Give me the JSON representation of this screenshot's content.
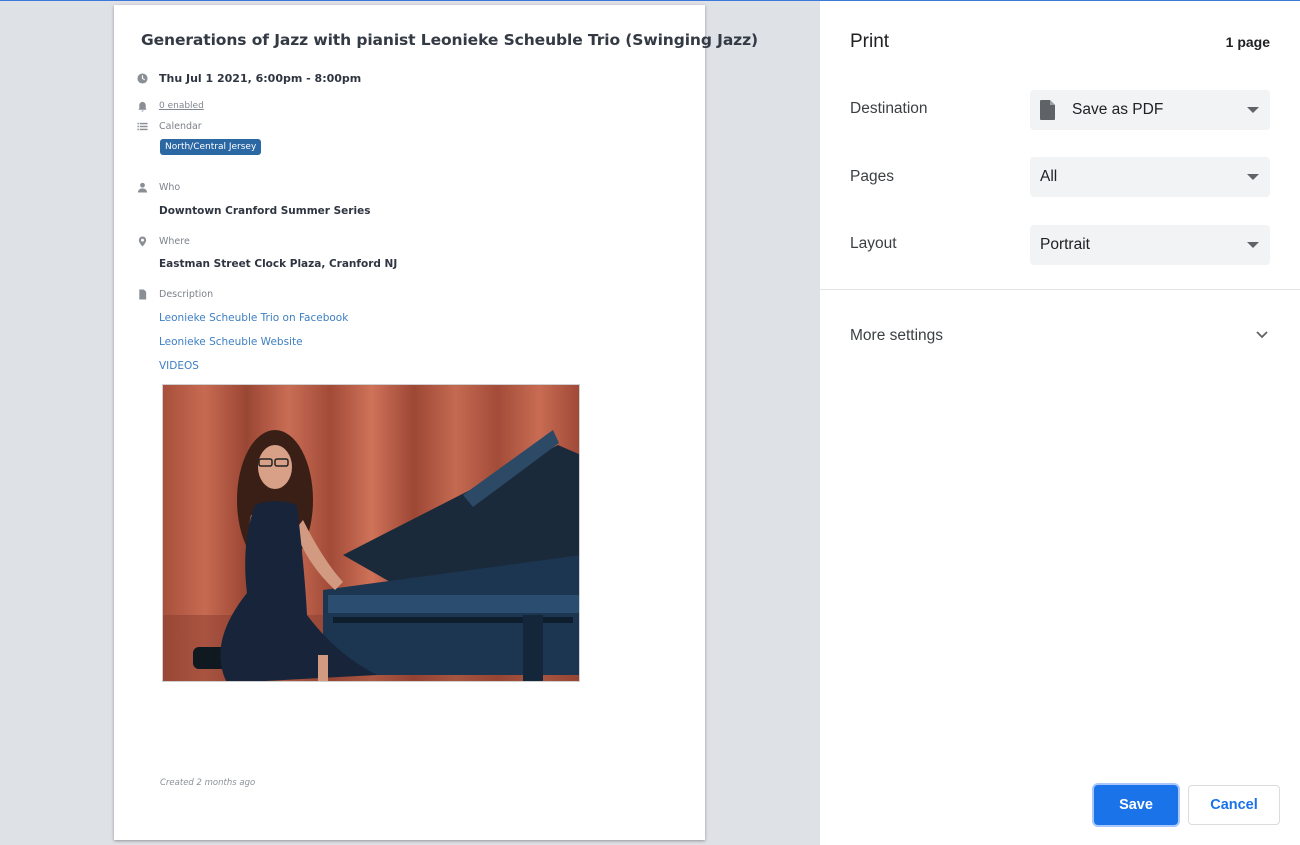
{
  "event": {
    "title": "Generations of Jazz with pianist Leonieke Scheuble Trio (Swinging Jazz)",
    "datetime": "Thu Jul 1 2021, 6:00pm - 8:00pm",
    "reminders": "0 enabled",
    "calendar_label": "Calendar",
    "calendar_badge": "North/Central Jersey",
    "who_label": "Who",
    "who_value": "Downtown Cranford Summer Series",
    "where_label": "Where",
    "where_value": "Eastman Street Clock Plaza, Cranford NJ",
    "description_label": "Description",
    "links": [
      "Leonieke Scheuble Trio on Facebook",
      "Leonieke Scheuble Website",
      "VIDEOS"
    ],
    "created": "Created 2 months ago"
  },
  "print": {
    "title": "Print",
    "page_count": "1 page",
    "destination_label": "Destination",
    "destination_value": "Save as PDF",
    "pages_label": "Pages",
    "pages_value": "All",
    "layout_label": "Layout",
    "layout_value": "Portrait",
    "more_settings": "More settings",
    "save_label": "Save",
    "cancel_label": "Cancel"
  },
  "colors": {
    "accent": "#1a73e8",
    "badge": "#2a67a3",
    "link": "#3d7fc2",
    "preview_bg": "#dee1e6"
  },
  "icons": {
    "datetime": "clock-icon",
    "reminders": "bell-icon",
    "calendar": "list-icon",
    "who": "person-icon",
    "where": "map-pin-icon",
    "description": "document-icon",
    "destination": "file-icon",
    "more_settings": "chevron-down-icon"
  }
}
